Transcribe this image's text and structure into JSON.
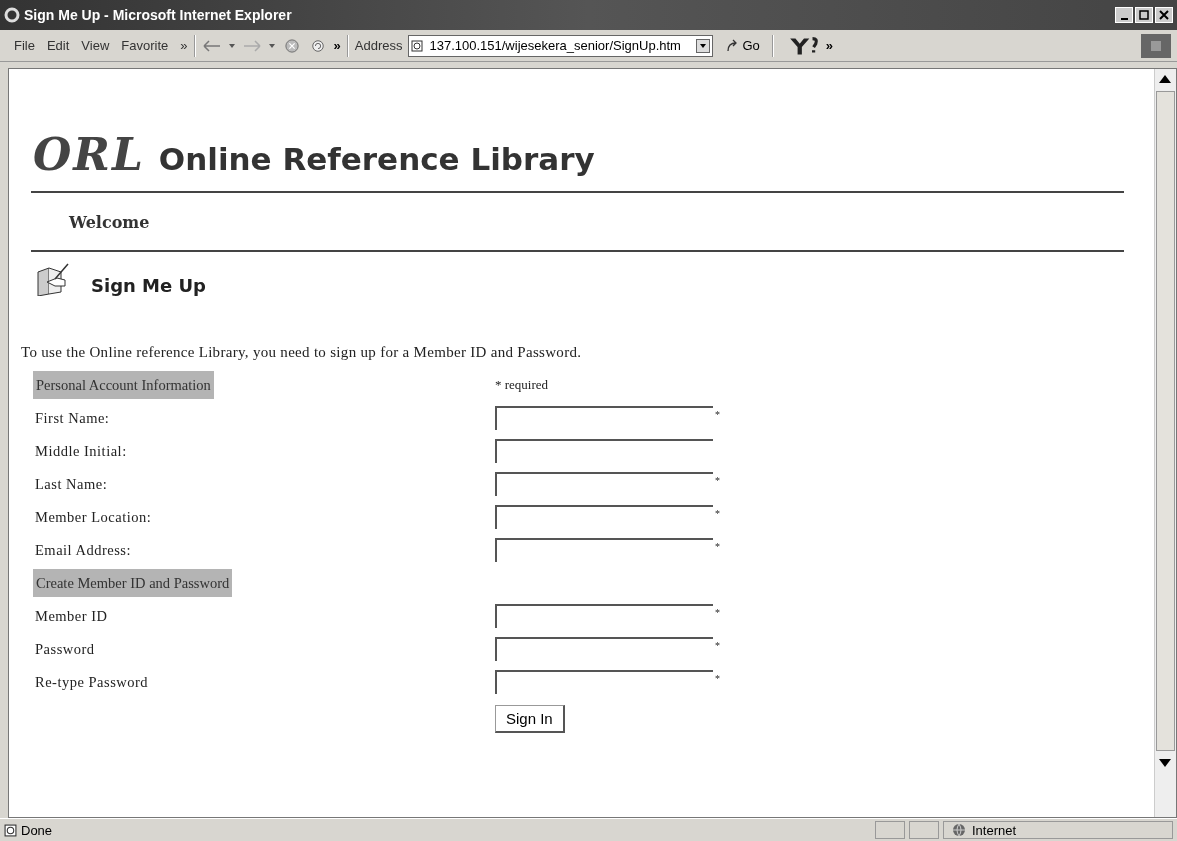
{
  "window": {
    "title": "Sign Me Up - Microsoft Internet Explorer"
  },
  "menu": [
    "File",
    "Edit",
    "View",
    "Favorite",
    "»"
  ],
  "toolbar": {
    "more": "»",
    "address_label": "Address",
    "url": "137.100.151/wijesekera_senior/SignUp.htm",
    "go": "Go",
    "links_more": "»"
  },
  "page": {
    "logo_mark": "ORL",
    "logo_text": "Online Reference Library",
    "nav": "Welcome",
    "heading": "Sign Me Up",
    "intro": "To use the Online reference Library, you need to sign up for a Member ID and Password.",
    "required_note": "* required",
    "required_mark": "*",
    "rows": [
      {
        "kind": "section",
        "label": "Personal Account Information"
      },
      {
        "kind": "field",
        "label": "First Name:",
        "required": true
      },
      {
        "kind": "field",
        "label": "Middle Initial:",
        "required": false
      },
      {
        "kind": "field",
        "label": "Last Name:",
        "required": true
      },
      {
        "kind": "field",
        "label": "Member Location:",
        "required": true
      },
      {
        "kind": "field",
        "label": "Email Address:",
        "required": true
      },
      {
        "kind": "section",
        "label": "Create Member ID and Password"
      },
      {
        "kind": "field",
        "label": "Member ID",
        "required": true
      },
      {
        "kind": "field",
        "label": "Password",
        "required": true
      },
      {
        "kind": "field",
        "label": "Re-type Password",
        "required": true
      }
    ],
    "button": "Sign In"
  },
  "status_bar": {
    "text": "Done",
    "zone": "Internet"
  }
}
